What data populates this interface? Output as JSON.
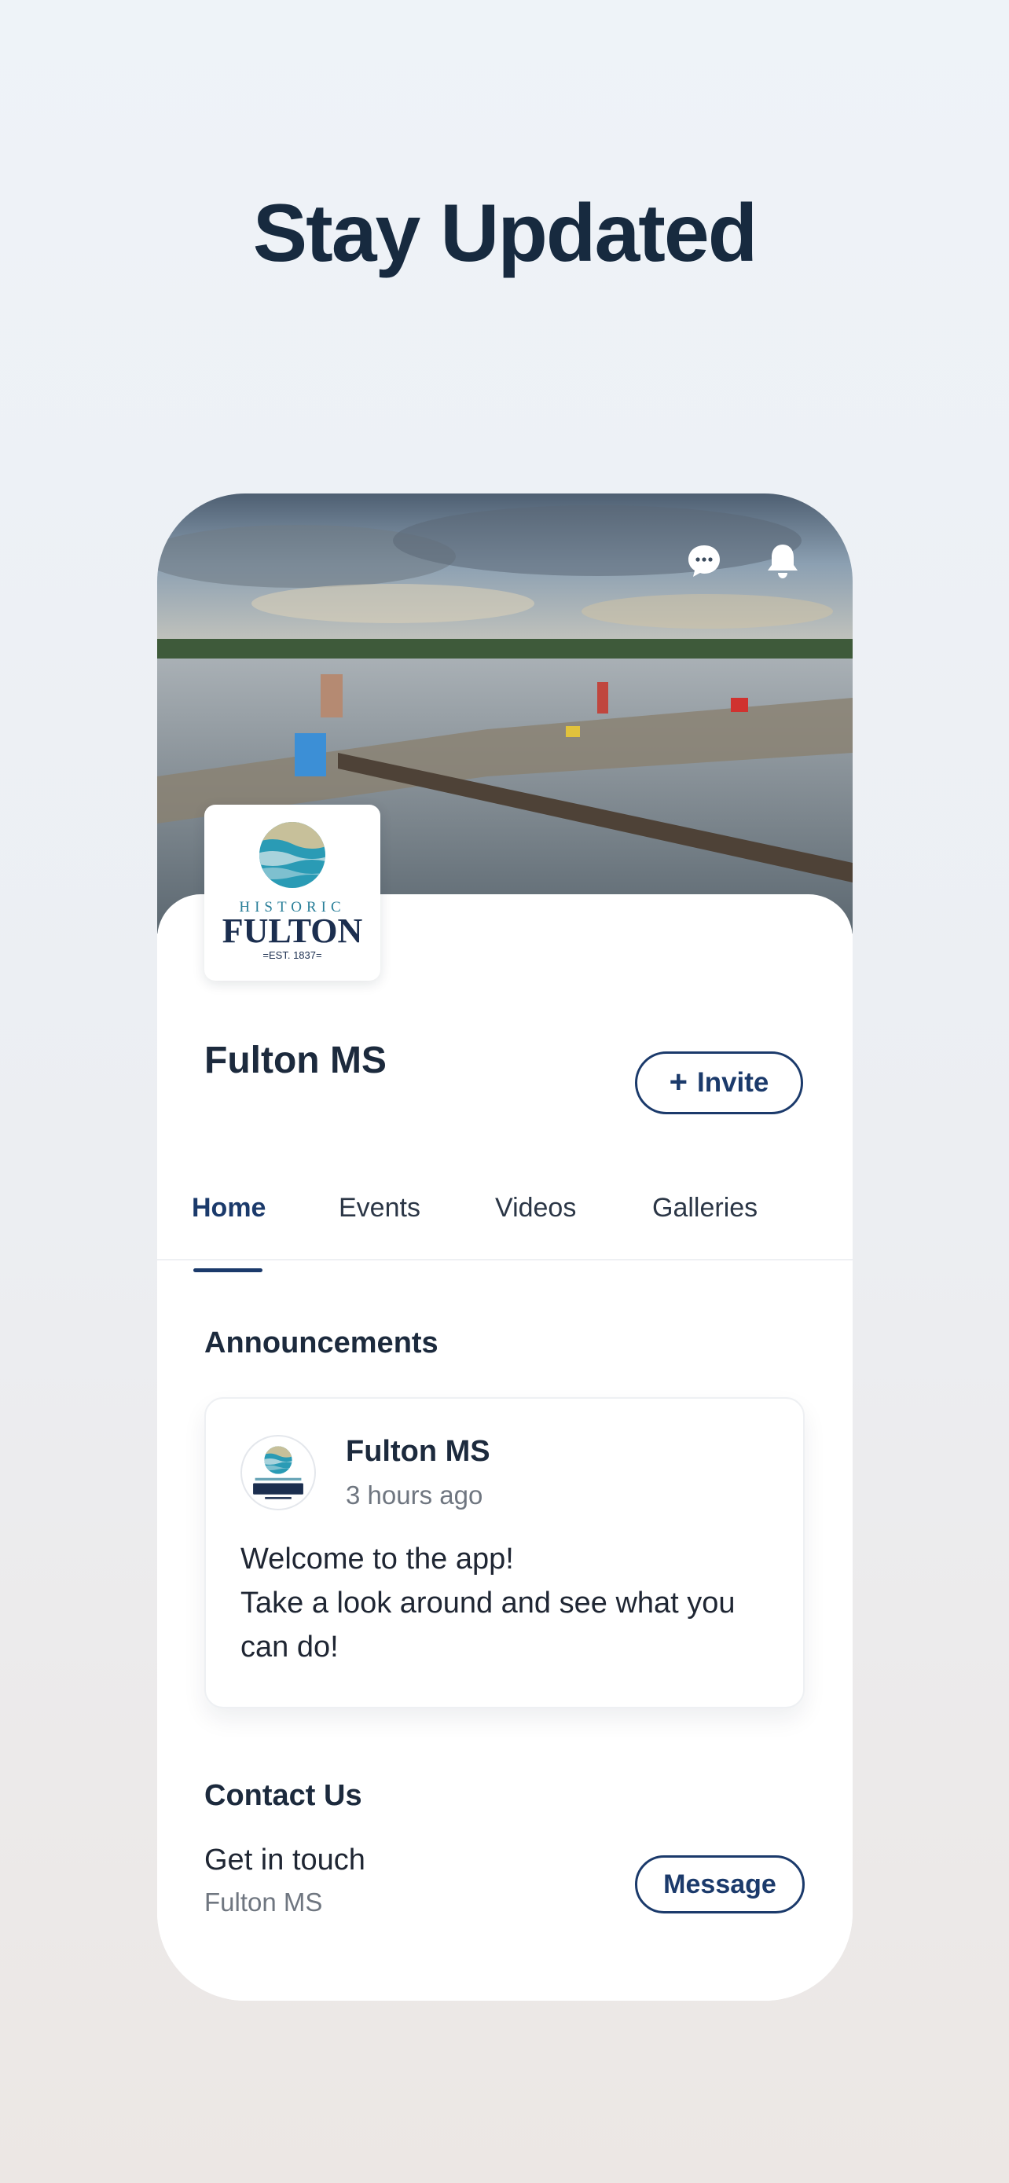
{
  "headline": "Stay Updated",
  "header": {
    "icons": [
      "chat-bubble-icon",
      "bell-icon"
    ]
  },
  "logo": {
    "word_top": "HISTORIC",
    "word_main": "FULTON",
    "word_bottom": "=EST. 1837="
  },
  "profile": {
    "name": "Fulton MS",
    "invite_label": "Invite"
  },
  "tabs": [
    {
      "label": "Home",
      "active": true
    },
    {
      "label": "Events",
      "active": false
    },
    {
      "label": "Videos",
      "active": false
    },
    {
      "label": "Galleries",
      "active": false
    }
  ],
  "announcements": {
    "title": "Announcements",
    "post": {
      "author": "Fulton MS",
      "time": "3 hours ago",
      "text": "Welcome to the app!\nTake a look around and see what you can do!"
    }
  },
  "contact": {
    "title": "Contact Us",
    "line1": "Get in touch",
    "line2": "Fulton MS",
    "message_label": "Message"
  },
  "colors": {
    "brand_navy": "#1b3a6b",
    "text_dark": "#1c2a3d",
    "muted": "#6f7680",
    "logo_teal": "#2a9bb5",
    "logo_sand": "#c7c09a"
  }
}
